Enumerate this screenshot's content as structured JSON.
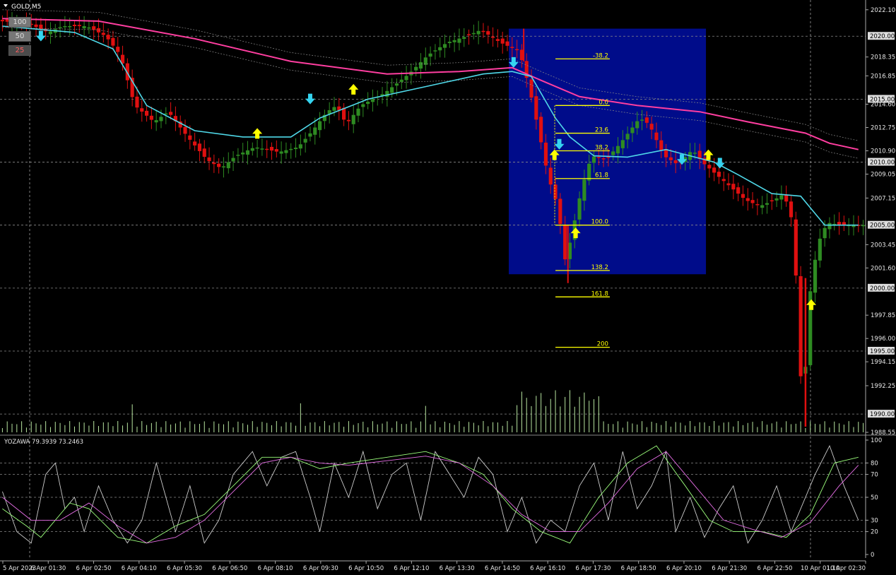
{
  "symbol_title": "GOLD,M5",
  "zoom_buttons": [
    "100",
    "50",
    "25"
  ],
  "colors": {
    "background": "#000000",
    "bull_bar": "#2e8b22",
    "bear_bar": "#e01010",
    "fast_ma": "#4fd8e8",
    "slow_ma": "#ff3ea0",
    "fib_box": "#000c8a",
    "fib_level": "#ffff00",
    "up_arrow": "#ffff00",
    "down_arrow": "#35d4f0",
    "volume": "#b8e6a0",
    "stoch_fast": "#cccccc",
    "stoch_k": "#9cff7c",
    "stoch_d": "#e66ee6"
  },
  "chart_data": [
    {
      "type": "line",
      "title": "GOLD,M5",
      "ylim": [
        1988.55,
        2022.65
      ],
      "y_ticks": [
        "2022.10",
        "2018.35",
        "2016.85",
        "2014.60",
        "2012.75",
        "2010.90",
        "2009.05",
        "2007.15",
        "2003.45",
        "2001.60",
        "1997.85",
        "1996.00",
        "1994.15",
        "1992.25",
        "1988.55"
      ],
      "price_marks": [
        "2020.00",
        "2015.00",
        "2010.00",
        "2005.00",
        "2000.00",
        "1995.00",
        "1990.00"
      ],
      "x_ticks": [
        "5 Apr 2023",
        "6 Apr 01:30",
        "6 Apr 02:50",
        "6 Apr 04:10",
        "6 Apr 05:30",
        "6 Apr 06:50",
        "6 Apr 08:10",
        "6 Apr 09:30",
        "6 Apr 10:50",
        "6 Apr 12:10",
        "6 Apr 13:30",
        "6 Apr 14:50",
        "6 Apr 16:10",
        "6 Apr 17:30",
        "6 Apr 18:50",
        "6 Apr 20:10",
        "6 Apr 21:30",
        "6 Apr 22:50",
        "10 Apr 01:10",
        "10 Apr 02:30"
      ],
      "close_path": [
        [
          0,
          2021.2
        ],
        [
          6,
          2021.0
        ],
        [
          10,
          2020.3
        ],
        [
          13,
          2020.8
        ],
        [
          18,
          2020.8
        ],
        [
          22,
          2020.0
        ],
        [
          25,
          2018.5
        ],
        [
          28,
          2014.5
        ],
        [
          32,
          2013.2
        ],
        [
          35,
          2014.0
        ],
        [
          39,
          2012.0
        ],
        [
          43,
          2010.2
        ],
        [
          46,
          2009.5
        ],
        [
          49,
          2010.5
        ],
        [
          53,
          2011.2
        ],
        [
          58,
          2010.8
        ],
        [
          62,
          2011.2
        ],
        [
          65,
          2012.5
        ],
        [
          68,
          2014.0
        ],
        [
          70,
          2014.5
        ],
        [
          72,
          2013.0
        ],
        [
          75,
          2014.5
        ],
        [
          80,
          2015.5
        ],
        [
          85,
          2017.0
        ],
        [
          89,
          2018.5
        ],
        [
          93,
          2019.5
        ],
        [
          97,
          2020.0
        ],
        [
          100,
          2020.5
        ],
        [
          104,
          2019.5
        ],
        [
          108,
          2018.8
        ],
        [
          110,
          2016.0
        ],
        [
          112,
          2012.5
        ],
        [
          114,
          2008.8
        ],
        [
          116,
          2006.5
        ],
        [
          117.6,
          2002.0
        ],
        [
          119,
          2004.5
        ],
        [
          121,
          2008.0
        ],
        [
          123,
          2010.5
        ],
        [
          126,
          2010.2
        ],
        [
          129,
          2011.5
        ],
        [
          133,
          2013.5
        ],
        [
          135,
          2013.0
        ],
        [
          138,
          2010.5
        ],
        [
          141,
          2009.8
        ],
        [
          144,
          2011.0
        ],
        [
          146,
          2010.0
        ],
        [
          149,
          2009.0
        ],
        [
          152,
          2008.0
        ],
        [
          155,
          2007.0
        ],
        [
          158,
          2006.5
        ],
        [
          161,
          2007.0
        ],
        [
          163,
          2007.5
        ],
        [
          165,
          2005.0
        ],
        [
          167,
          1989.0
        ],
        [
          168,
          1998.5
        ],
        [
          170,
          2003.5
        ],
        [
          172,
          2005.2
        ],
        [
          175,
          2005.0
        ],
        [
          178,
          2005.0
        ]
      ],
      "series": [
        {
          "values": [
            [
              0,
              2020.8
            ],
            [
              15,
              2020.3
            ],
            [
              23,
              2019.0
            ],
            [
              30,
              2014.5
            ],
            [
              40,
              2012.5
            ],
            [
              50,
              2012.0
            ],
            [
              60,
              2012.0
            ],
            [
              66,
              2013.5
            ],
            [
              76,
              2015.0
            ],
            [
              88,
              2016.0
            ],
            [
              100,
              2017.0
            ],
            [
              106,
              2017.2
            ],
            [
              110,
              2016.8
            ],
            [
              115,
              2013.5
            ],
            [
              118,
              2012.0
            ],
            [
              123,
              2010.5
            ],
            [
              130,
              2010.4
            ],
            [
              138,
              2011.0
            ],
            [
              143,
              2010.5
            ],
            [
              148,
              2010.0
            ],
            [
              153,
              2009.0
            ],
            [
              160,
              2007.5
            ],
            [
              166,
              2007.3
            ],
            [
              171,
              2005.0
            ],
            [
              178,
              2005.0
            ]
          ]
        },
        {
          "values": [
            [
              0,
              2021.4
            ],
            [
              20,
              2021.2
            ],
            [
              40,
              2019.8
            ],
            [
              60,
              2018.0
            ],
            [
              80,
              2017.0
            ],
            [
              95,
              2017.2
            ],
            [
              106,
              2017.5
            ],
            [
              112,
              2016.5
            ],
            [
              120,
              2015.2
            ],
            [
              132,
              2014.5
            ],
            [
              145,
              2014.0
            ],
            [
              155,
              2013.2
            ],
            [
              167,
              2012.3
            ],
            [
              172,
              2011.5
            ],
            [
              178,
              2011.0
            ]
          ]
        }
      ],
      "fibonacci": {
        "levels": [
          "-38.2",
          "0.0",
          "23.6",
          "38.2",
          "61.8",
          "100.0",
          "138.2",
          "161.8",
          "200"
        ],
        "prices": [
          2018.2,
          2014.5,
          2012.3,
          2010.9,
          2008.7,
          2005.0,
          2001.4,
          1999.3,
          1995.3
        ]
      },
      "signals_up": [
        [
          53,
          2012.2
        ],
        [
          73,
          2015.7
        ],
        [
          114.8,
          2010.5
        ],
        [
          119.2,
          2004.3
        ],
        [
          146.8,
          2010.5
        ],
        [
          168.2,
          1998.6
        ]
      ],
      "signals_down": [
        [
          8,
          2020.1
        ],
        [
          64,
          2015.1
        ],
        [
          106.3,
          2018.0
        ],
        [
          115.8,
          2011.5
        ],
        [
          141.3,
          2010.3
        ],
        [
          149.2,
          2010.0
        ]
      ]
    },
    {
      "type": "line",
      "title": "YOZAWA 79.3939 73.2463",
      "ylim": [
        0,
        100
      ],
      "y_ticks": [
        "100",
        "80",
        "70",
        "50",
        "30",
        "20",
        "0"
      ],
      "series": [
        {
          "values": [
            [
              0,
              55
            ],
            [
              3,
              20
            ],
            [
              6,
              10
            ],
            [
              9,
              70
            ],
            [
              11,
              80
            ],
            [
              13,
              40
            ],
            [
              15,
              50
            ],
            [
              17,
              20
            ],
            [
              20,
              60
            ],
            [
              23,
              30
            ],
            [
              26,
              10
            ],
            [
              29,
              30
            ],
            [
              32,
              80
            ],
            [
              34,
              50
            ],
            [
              36,
              20
            ],
            [
              39,
              60
            ],
            [
              42,
              10
            ],
            [
              45,
              30
            ],
            [
              48,
              70
            ],
            [
              52,
              90
            ],
            [
              55,
              60
            ],
            [
              58,
              85
            ],
            [
              61,
              90
            ],
            [
              64,
              50
            ],
            [
              66,
              20
            ],
            [
              69,
              80
            ],
            [
              72,
              50
            ],
            [
              75,
              90
            ],
            [
              78,
              40
            ],
            [
              81,
              70
            ],
            [
              84,
              80
            ],
            [
              87,
              30
            ],
            [
              90,
              90
            ],
            [
              93,
              70
            ],
            [
              96,
              50
            ],
            [
              99,
              85
            ],
            [
              102,
              70
            ],
            [
              105,
              20
            ],
            [
              108,
              50
            ],
            [
              111,
              10
            ],
            [
              114,
              30
            ],
            [
              117,
              20
            ],
            [
              120,
              60
            ],
            [
              123,
              80
            ],
            [
              126,
              30
            ],
            [
              129,
              90
            ],
            [
              132,
              40
            ],
            [
              135,
              60
            ],
            [
              138,
              90
            ],
            [
              140,
              20
            ],
            [
              143,
              50
            ],
            [
              146,
              15
            ],
            [
              149,
              40
            ],
            [
              152,
              60
            ],
            [
              155,
              10
            ],
            [
              158,
              30
            ],
            [
              161,
              60
            ],
            [
              164,
              20
            ],
            [
              166,
              40
            ],
            [
              169,
              70
            ],
            [
              172,
              95
            ],
            [
              175,
              60
            ],
            [
              178,
              30
            ]
          ]
        },
        {
          "values": [
            [
              0,
              40
            ],
            [
              5,
              25
            ],
            [
              8,
              15
            ],
            [
              14,
              45
            ],
            [
              18,
              40
            ],
            [
              24,
              15
            ],
            [
              30,
              10
            ],
            [
              36,
              25
            ],
            [
              42,
              35
            ],
            [
              48,
              60
            ],
            [
              54,
              85
            ],
            [
              60,
              85
            ],
            [
              66,
              75
            ],
            [
              72,
              80
            ],
            [
              80,
              85
            ],
            [
              88,
              90
            ],
            [
              95,
              80
            ],
            [
              100,
              70
            ],
            [
              106,
              40
            ],
            [
              112,
              20
            ],
            [
              118,
              10
            ],
            [
              124,
              50
            ],
            [
              130,
              80
            ],
            [
              136,
              95
            ],
            [
              142,
              60
            ],
            [
              147,
              30
            ],
            [
              152,
              20
            ],
            [
              158,
              20
            ],
            [
              163,
              15
            ],
            [
              168,
              35
            ],
            [
              173,
              80
            ],
            [
              178,
              85
            ]
          ]
        },
        {
          "values": [
            [
              0,
              50
            ],
            [
              6,
              30
            ],
            [
              12,
              30
            ],
            [
              18,
              45
            ],
            [
              24,
              25
            ],
            [
              30,
              10
            ],
            [
              36,
              15
            ],
            [
              42,
              30
            ],
            [
              48,
              55
            ],
            [
              54,
              80
            ],
            [
              60,
              85
            ],
            [
              66,
              80
            ],
            [
              72,
              78
            ],
            [
              80,
              82
            ],
            [
              88,
              86
            ],
            [
              95,
              80
            ],
            [
              102,
              60
            ],
            [
              108,
              35
            ],
            [
              114,
              20
            ],
            [
              120,
              20
            ],
            [
              126,
              45
            ],
            [
              132,
              75
            ],
            [
              138,
              90
            ],
            [
              144,
              60
            ],
            [
              150,
              30
            ],
            [
              156,
              22
            ],
            [
              162,
              15
            ],
            [
              168,
              28
            ],
            [
              174,
              60
            ],
            [
              178,
              78
            ]
          ]
        }
      ]
    }
  ]
}
